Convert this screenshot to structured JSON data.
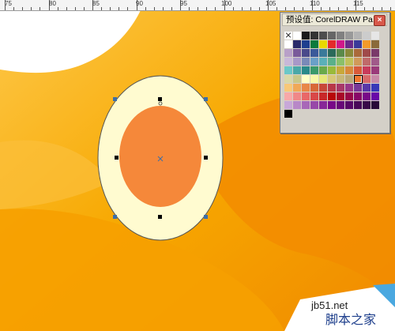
{
  "ruler": {
    "ticks": [
      "75",
      "80",
      "85",
      "90",
      "95",
      "100",
      "105",
      "110",
      "115"
    ]
  },
  "palette": {
    "title": "预设值: CorelDRAW Pa...",
    "close_glyph": "×",
    "swatches": [
      "none",
      "#ffffff",
      "#1a1a1a",
      "#333333",
      "#4d4d4d",
      "#666666",
      "#808080",
      "#999999",
      "#b3b3b3",
      "#cccccc",
      "#e6e6e6",
      "#ffffff",
      "#2b2b6b",
      "#1f3f8f",
      "#0a7a3c",
      "#e8d800",
      "#e42a2a",
      "#d0188a",
      "#6a2a8a",
      "#3a3a9a",
      "#f29a2a",
      "#8a6a3a",
      "#b8a0c8",
      "#7a5a9a",
      "#4a4a8a",
      "#3a5a9a",
      "#3a7a9a",
      "#2a6a5a",
      "#5a8a4a",
      "#8a8a3a",
      "#aa6a3a",
      "#a04a4a",
      "#7a3a6a",
      "#c8b8d8",
      "#a898c8",
      "#7a8ab8",
      "#6aa0c8",
      "#5ab0b8",
      "#5ab08a",
      "#8ac06a",
      "#c0c05a",
      "#d09a5a",
      "#c06a6a",
      "#a05a8a",
      "#6ac8c8",
      "#4aa8a8",
      "#2a8a8a",
      "#3a9a6a",
      "#6aaa4a",
      "#9aba3a",
      "#c8a83a",
      "#d8883a",
      "#d85a3a",
      "#c83a5a",
      "#9a3a7a",
      "#d8d8a8",
      "#c8c88a",
      "#ffffc8",
      "#f8f8a8",
      "#e8e878",
      "#d8c878",
      "#c8b878",
      "#b8a878",
      "#f07830",
      "#d86a6a",
      "#c88aa8",
      "#f8c878",
      "#f0a858",
      "#e88848",
      "#d86838",
      "#c84838",
      "#b83848",
      "#a83868",
      "#983888",
      "#783898",
      "#5838a8",
      "#3838b8",
      "#f8a8a8",
      "#f08888",
      "#e86868",
      "#d84848",
      "#c82828",
      "#b80808",
      "#a80828",
      "#980848",
      "#880868",
      "#780888",
      "#6808a8",
      "#c8a8d8",
      "#b888c8",
      "#a868b8",
      "#9848a8",
      "#882898",
      "#780888",
      "#680878",
      "#580868",
      "#480858",
      "#380848",
      "#280838",
      "#000000",
      "#d4d0c8",
      "#d4d0c8",
      "#d4d0c8",
      "#d4d0c8",
      "#d4d0c8",
      "#d4d0c8",
      "#d4d0c8",
      "#d4d0c8",
      "#d4d0c8",
      "#d4d0c8"
    ],
    "selected_index": 63
  },
  "shape": {
    "outer_fill": "#fffbd0",
    "inner_fill": "#f5883a",
    "outline": "#555555"
  },
  "canvas": {
    "background_primary": "#f59a00",
    "background_light": "#fdc15a"
  },
  "watermark": {
    "line1": "jb51.net",
    "line2": "脚本之家"
  }
}
